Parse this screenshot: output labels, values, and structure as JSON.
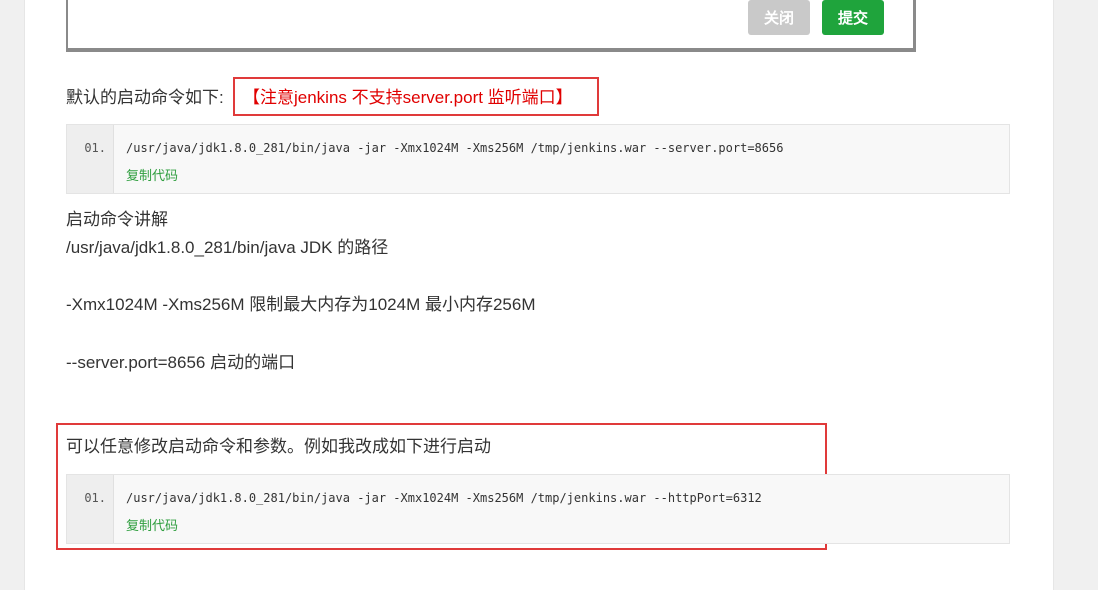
{
  "dialog": {
    "close_label": "关闭",
    "submit_label": "提交"
  },
  "intro": {
    "label": "默认的启动命令如下:",
    "notice": "【注意jenkins 不支持server.port 监听端口】"
  },
  "code_block_1": {
    "line_no": "01.",
    "code": "/usr/java/jdk1.8.0_281/bin/java -jar -Xmx1024M -Xms256M  /tmp/jenkins.war --server.port=8656",
    "copy_label": "复制代码"
  },
  "explain": {
    "heading": "启动命令讲解",
    "line1": "/usr/java/jdk1.8.0_281/bin/java    JDK 的路径",
    "line2": "-Xmx1024M -Xms256M   限制最大内存为1024M  最小内存256M",
    "line3": "--server.port=8656      启动的端口"
  },
  "modify": {
    "text": "可以任意修改启动命令和参数。例如我改成如下进行启动"
  },
  "code_block_2": {
    "line_no": "01.",
    "code": "/usr/java/jdk1.8.0_281/bin/java -jar -Xmx1024M -Xms256M  /tmp/jenkins.war --httpPort=6312",
    "copy_label": "复制代码"
  }
}
